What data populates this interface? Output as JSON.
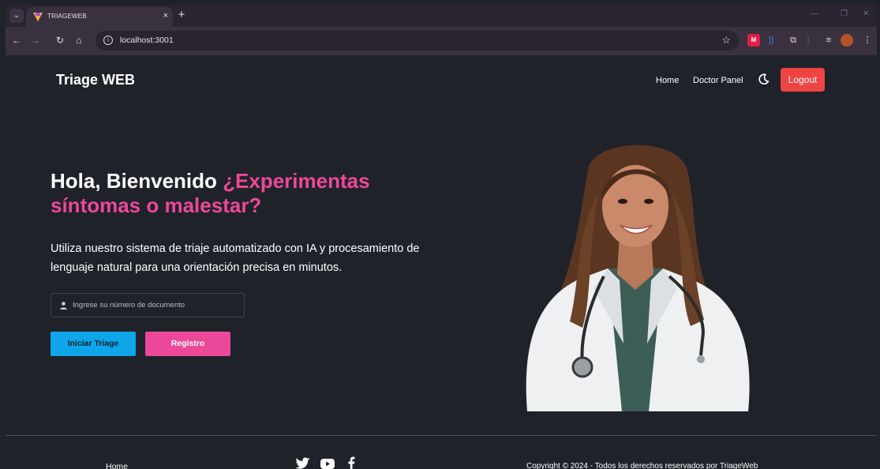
{
  "browser": {
    "tab_title": "TRIAGEWEB",
    "tab_close": "×",
    "new_tab": "+",
    "url": "localhost:3001",
    "icons": [
      "back-arrow-icon",
      "forward-arrow-icon",
      "reload-icon",
      "home-icon",
      "site-info-icon",
      "bookmark-star-icon"
    ]
  },
  "navbar": {
    "brand": "Triage WEB",
    "links": [
      "Home",
      "Doctor Panel"
    ],
    "logout_label": "Logout"
  },
  "hero": {
    "title_plain": "Hola, Bienvenido ",
    "title_accent": "¿Experimentas síntomas o malestar?",
    "description": "Utiliza nuestro sistema de triaje automatizado con IA y procesamiento de lenguaje natural para una orientación precisa en minutos.",
    "document_placeholder": "Ingrese su número de documento",
    "document_value": "",
    "start_button": "Iniciar Triage",
    "register_button": "Registro"
  },
  "footer": {
    "home": "Home",
    "social": [
      "twitter-icon",
      "youtube-icon",
      "facebook-icon"
    ],
    "copyright": "Copyright © 2024 - Todos los derechos reservados por TriageWeb"
  },
  "colors": {
    "background": "#1f2229",
    "accent_pink": "#ec4899",
    "primary_blue": "#0ea5e9",
    "logout_red": "#ef4444"
  }
}
